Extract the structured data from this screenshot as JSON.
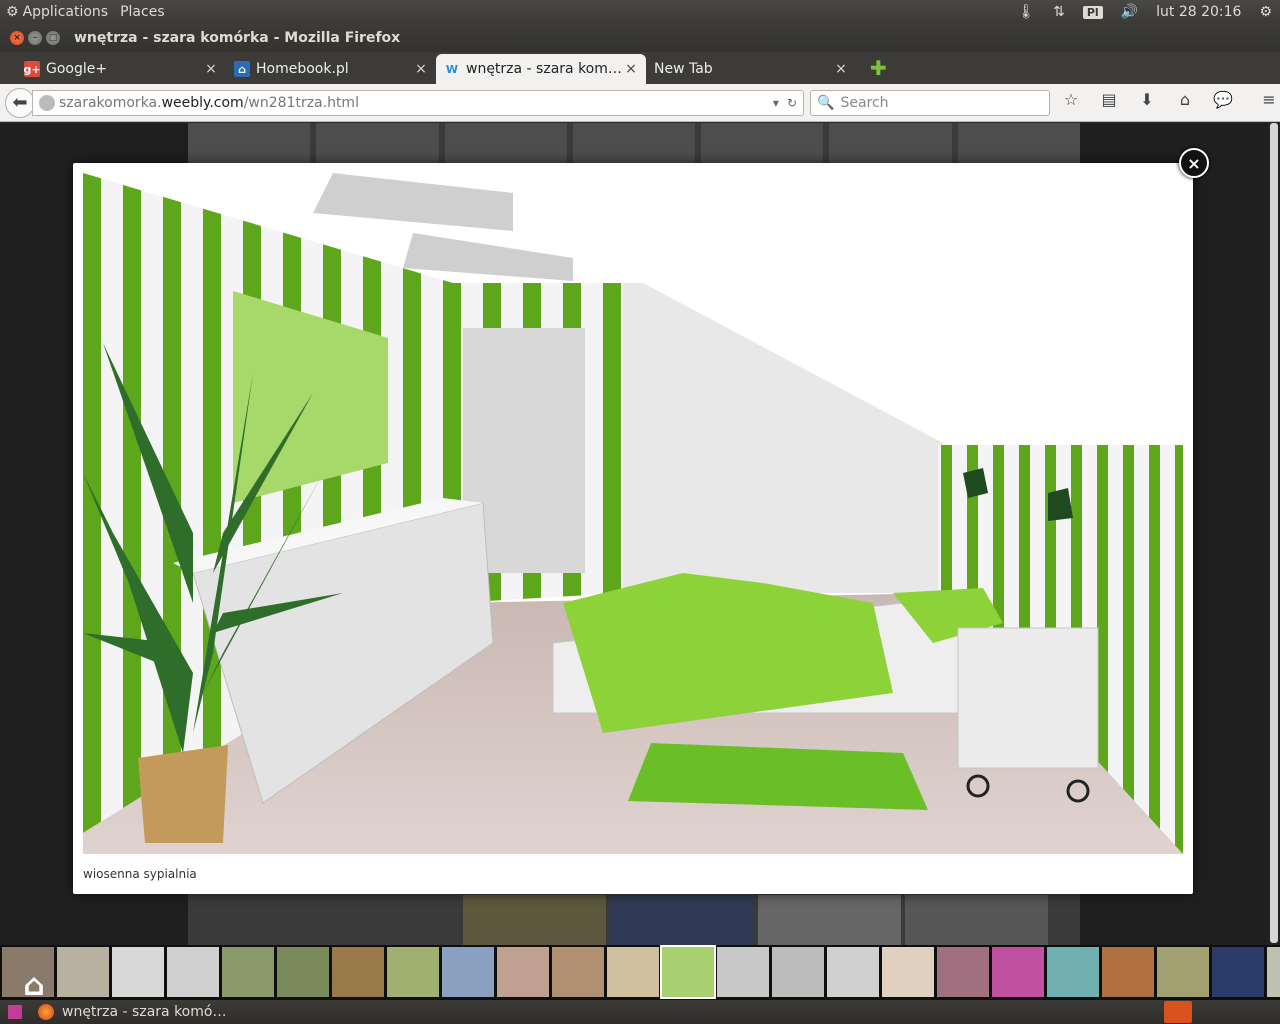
{
  "top_panel": {
    "applications": "Applications",
    "places": "Places",
    "lang": "Pl",
    "clock": "lut 28 20:16"
  },
  "window": {
    "title": "wnętrza - szara komórka - Mozilla Firefox"
  },
  "tabs": [
    {
      "label": "Google+",
      "favicon": "g+",
      "favicon_color": "#dd4b39"
    },
    {
      "label": "Homebook.pl",
      "favicon": "home",
      "favicon_color": "#2a6db5"
    },
    {
      "label": "wnętrza - szara kom…",
      "favicon": "w",
      "favicon_color": "#2a8bd8",
      "active": true
    },
    {
      "label": "New Tab",
      "favicon": "",
      "favicon_color": ""
    }
  ],
  "navbar": {
    "url_prefix": "szarakomorka.",
    "url_host": "weebly.com",
    "url_path": "/wn281trza.html",
    "search_placeholder": "Search"
  },
  "lightbox": {
    "caption": "wiosenna sypialnia",
    "close_label": "×"
  },
  "taskbar": {
    "window_label": "wnętrza - szara komó…"
  },
  "colors": {
    "accent_green": "#7ec23b",
    "stripe_green": "#5ea61c",
    "wall_white": "#f0f0f0"
  }
}
